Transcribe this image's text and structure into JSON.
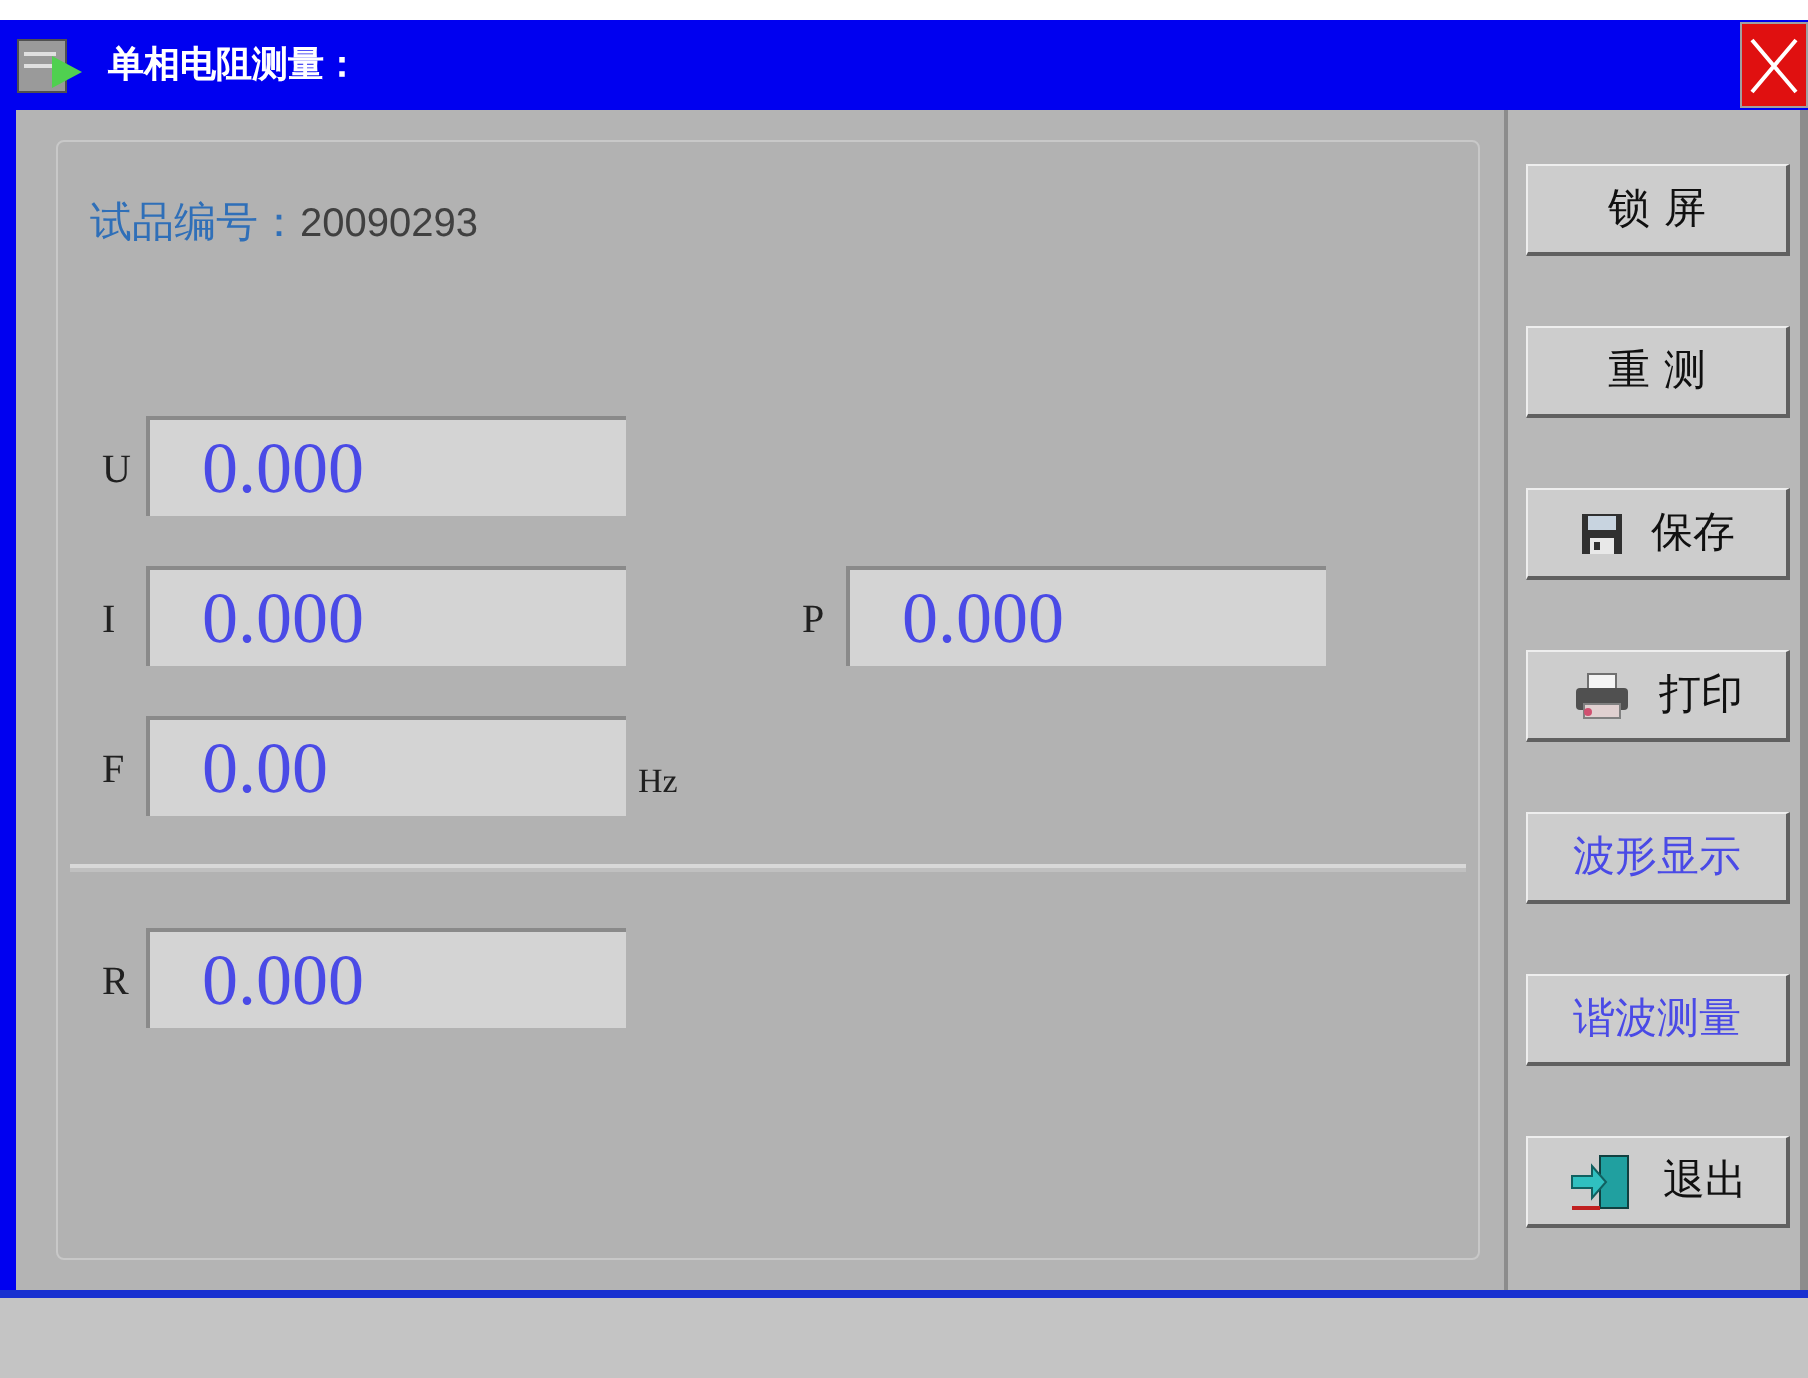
{
  "window": {
    "title": "单相电阻测量："
  },
  "sample": {
    "label": "试品编号：",
    "value": "20090293"
  },
  "rows": [
    [
      {
        "label": "U",
        "value": "0.000"
      }
    ],
    [
      {
        "label": "I",
        "value": "0.000"
      },
      {
        "label": "P",
        "value": "0.000"
      }
    ],
    [
      {
        "label": "F",
        "value": "0.00",
        "unit": "Hz"
      }
    ]
  ],
  "result": {
    "label": "R",
    "value": "0.000"
  },
  "buttons": [
    {
      "label": "锁 屏",
      "kind": "plain"
    },
    {
      "label": "重 测",
      "kind": "plain"
    },
    {
      "label": "保存",
      "kind": "save"
    },
    {
      "label": "打印",
      "kind": "print"
    },
    {
      "label": "波形显示",
      "kind": "function"
    },
    {
      "label": "谐波测量",
      "kind": "function"
    },
    {
      "label": "退出",
      "kind": "exit"
    }
  ]
}
